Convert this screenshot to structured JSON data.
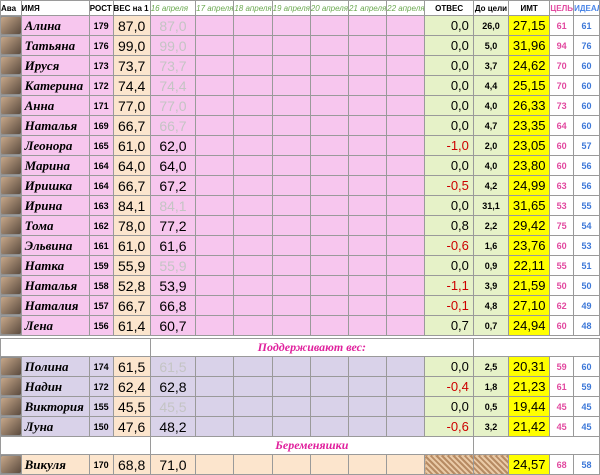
{
  "headers": {
    "ava": "Ава",
    "name": "ИМЯ",
    "height": "РОСТ",
    "weight_start": "ВЕС на 1 мар",
    "dates": [
      "16 апреля",
      "17 апреля",
      "18 апреля",
      "19 апреля",
      "20 апреля",
      "21 апреля",
      "22 апреля"
    ],
    "otves": "ОТВЕС",
    "do_celi": "До цели",
    "imt": "ИМТ",
    "cel": "ЦЕЛЬ",
    "ideal": "ИДЕАЛ"
  },
  "section_titles": {
    "support": "Поддерживают вес:",
    "pregnant": "Беременяшки"
  },
  "main_rows": [
    {
      "name": "Алина",
      "height": "179",
      "w1": "87,0",
      "w2": "87,0",
      "faded": true,
      "otves": "0,0",
      "neg": false,
      "do_celi": "26,0",
      "imt": "27,15",
      "cel": "61",
      "ideal": "61"
    },
    {
      "name": "Татьяна",
      "height": "176",
      "w1": "99,0",
      "w2": "99,0",
      "faded": true,
      "otves": "0,0",
      "neg": false,
      "do_celi": "5,0",
      "imt": "31,96",
      "cel": "94",
      "ideal": "76"
    },
    {
      "name": "Ируся",
      "height": "173",
      "w1": "73,7",
      "w2": "73,7",
      "faded": true,
      "otves": "0,0",
      "neg": false,
      "do_celi": "3,7",
      "imt": "24,62",
      "cel": "70",
      "ideal": "60"
    },
    {
      "name": "Катерина",
      "height": "172",
      "w1": "74,4",
      "w2": "74,4",
      "faded": true,
      "otves": "0,0",
      "neg": false,
      "do_celi": "4,4",
      "imt": "25,15",
      "cel": "70",
      "ideal": "60"
    },
    {
      "name": "Анна",
      "height": "171",
      "w1": "77,0",
      "w2": "77,0",
      "faded": true,
      "otves": "0,0",
      "neg": false,
      "do_celi": "4,0",
      "imt": "26,33",
      "cel": "73",
      "ideal": "60"
    },
    {
      "name": "Наталья",
      "height": "169",
      "w1": "66,7",
      "w2": "66,7",
      "faded": true,
      "otves": "0,0",
      "neg": false,
      "do_celi": "4,7",
      "imt": "23,35",
      "cel": "64",
      "ideal": "60"
    },
    {
      "name": "Леонора",
      "height": "165",
      "w1": "61,0",
      "w2": "62,0",
      "faded": false,
      "otves": "-1,0",
      "neg": true,
      "do_celi": "2,0",
      "imt": "23,05",
      "cel": "60",
      "ideal": "57"
    },
    {
      "name": "Марина",
      "height": "164",
      "w1": "64,0",
      "w2": "64,0",
      "faded": false,
      "otves": "0,0",
      "neg": false,
      "do_celi": "4,0",
      "imt": "23,80",
      "cel": "60",
      "ideal": "56"
    },
    {
      "name": "Иришка",
      "height": "164",
      "w1": "66,7",
      "w2": "67,2",
      "faded": false,
      "otves": "-0,5",
      "neg": true,
      "do_celi": "4,2",
      "imt": "24,99",
      "cel": "63",
      "ideal": "56"
    },
    {
      "name": "Ирина",
      "height": "163",
      "w1": "84,1",
      "w2": "84,1",
      "faded": true,
      "otves": "0,0",
      "neg": false,
      "do_celi": "31,1",
      "imt": "31,65",
      "cel": "53",
      "ideal": "55"
    },
    {
      "name": "Тома",
      "height": "162",
      "w1": "78,0",
      "w2": "77,2",
      "faded": false,
      "otves": "0,8",
      "neg": false,
      "do_celi": "2,2",
      "imt": "29,42",
      "cel": "75",
      "ideal": "54"
    },
    {
      "name": "Эльвина",
      "height": "161",
      "w1": "61,0",
      "w2": "61,6",
      "faded": false,
      "otves": "-0,6",
      "neg": true,
      "do_celi": "1,6",
      "imt": "23,76",
      "cel": "60",
      "ideal": "53"
    },
    {
      "name": "Натка",
      "height": "159",
      "w1": "55,9",
      "w2": "55,9",
      "faded": true,
      "otves": "0,0",
      "neg": false,
      "do_celi": "0,9",
      "imt": "22,11",
      "cel": "55",
      "ideal": "51"
    },
    {
      "name": "Наталья",
      "height": "158",
      "w1": "52,8",
      "w2": "53,9",
      "faded": false,
      "otves": "-1,1",
      "neg": true,
      "do_celi": "3,9",
      "imt": "21,59",
      "cel": "50",
      "ideal": "50"
    },
    {
      "name": "Наталия",
      "height": "157",
      "w1": "66,7",
      "w2": "66,8",
      "faded": false,
      "otves": "-0,1",
      "neg": true,
      "do_celi": "4,8",
      "imt": "27,10",
      "cel": "62",
      "ideal": "49"
    },
    {
      "name": "Лена",
      "height": "156",
      "w1": "61,4",
      "w2": "60,7",
      "faded": false,
      "otves": "0,7",
      "neg": false,
      "do_celi": "0,7",
      "imt": "24,94",
      "cel": "60",
      "ideal": "48"
    }
  ],
  "support_rows": [
    {
      "name": "Полина",
      "height": "174",
      "w1": "61,5",
      "w2": "61,5",
      "faded": true,
      "otves": "0,0",
      "neg": false,
      "do_celi": "2,5",
      "imt": "20,31",
      "cel": "59",
      "ideal": "60"
    },
    {
      "name": "Надин",
      "height": "172",
      "w1": "62,4",
      "w2": "62,8",
      "faded": false,
      "otves": "-0,4",
      "neg": true,
      "do_celi": "1,8",
      "imt": "21,23",
      "cel": "61",
      "ideal": "59"
    },
    {
      "name": "Виктория",
      "height": "155",
      "w1": "45,5",
      "w2": "45,5",
      "faded": true,
      "otves": "0,0",
      "neg": false,
      "do_celi": "0,5",
      "imt": "19,44",
      "cel": "45",
      "ideal": "45"
    },
    {
      "name": "Луна",
      "height": "150",
      "w1": "47,6",
      "w2": "48,2",
      "faded": false,
      "otves": "-0,6",
      "neg": true,
      "do_celi": "3,2",
      "imt": "21,42",
      "cel": "45",
      "ideal": "45"
    }
  ],
  "pregnant_rows": [
    {
      "name": "Викуля",
      "height": "170",
      "w1": "68,8",
      "w2": "71,0",
      "imt": "24,57",
      "cel": "68",
      "ideal": "58"
    }
  ]
}
